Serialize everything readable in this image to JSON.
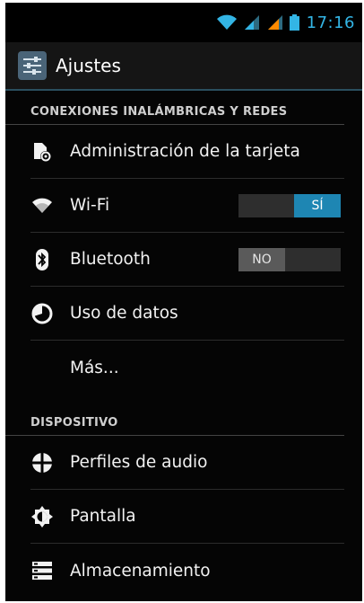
{
  "status_bar": {
    "time": "17:16",
    "icons": [
      "wifi-icon",
      "signal-icon",
      "signal-icon-2",
      "battery-icon"
    ]
  },
  "action_bar": {
    "title": "Ajustes",
    "icon": "settings-app-icon"
  },
  "sections": {
    "wireless": {
      "header": "CONEXIONES INALÁMBRICAS Y REDES",
      "items": [
        {
          "label": "Administración de la tarjeta",
          "icon": "sim-card-icon"
        },
        {
          "label": "Wi-Fi",
          "icon": "wifi-icon",
          "toggle": "SÍ",
          "toggle_state": "on"
        },
        {
          "label": "Bluetooth",
          "icon": "bluetooth-icon",
          "toggle": "NO",
          "toggle_state": "off"
        },
        {
          "label": "Uso de datos",
          "icon": "data-usage-icon"
        },
        {
          "label": "Más..."
        }
      ]
    },
    "device": {
      "header": "DISPOSITIVO",
      "items": [
        {
          "label": "Perfiles de audio",
          "icon": "audio-profiles-icon"
        },
        {
          "label": "Pantalla",
          "icon": "display-icon"
        },
        {
          "label": "Almacenamiento",
          "icon": "storage-icon"
        }
      ]
    }
  },
  "colors": {
    "accent": "#33b5e5",
    "toggle_on": "#1e86b3",
    "background": "#050505"
  }
}
